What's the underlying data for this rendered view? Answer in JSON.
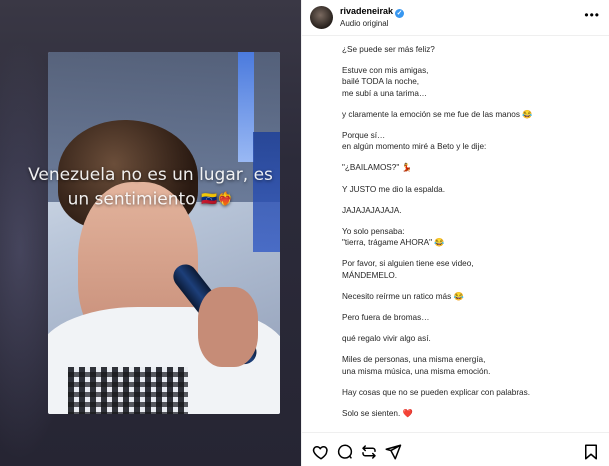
{
  "media": {
    "overlay_line1": "Venezuela no es un lugar, es",
    "overlay_line2": "un sentimiento",
    "overlay_emojis": "🇻🇪❤️‍🔥"
  },
  "header": {
    "username": "rivadeneirak",
    "verified_mark": "✓",
    "audio_label": "Audio original",
    "more_label": "•••"
  },
  "caption": [
    "¿Se puede ser más feliz?",
    "Estuve con mis amigas,\nbailé TODA la noche,\nme subí a una tarima…",
    "y claramente la emoción se me fue de las manos 😂",
    "Porque sí…\nen algún momento miré a Beto y le dije:",
    "\"¿BAILAMOS?\" 💃",
    "Y JUSTO me dio la espalda.",
    "JAJAJAJAJAJA.",
    "Yo solo pensaba:\n\"tierra, trágame AHORA\" 😂",
    "Por favor, si alguien tiene ese video,\nMÁNDEMELO.",
    "Necesito reírme un ratico más 😂",
    "Pero fuera de bromas…",
    "qué regalo vivir algo así.",
    "Miles de personas, una misma energía,\nuna misma música, una misma emoción.",
    "Hay cosas que no se pueden explicar con palabras.",
    "Solo se sienten. ❤️"
  ],
  "icons": [
    "heart-icon",
    "comment-icon",
    "share-icon",
    "send-icon",
    "bookmark-icon"
  ],
  "colors": {
    "verified": "#3897f0",
    "text": "#262626",
    "divider": "#efefef"
  }
}
